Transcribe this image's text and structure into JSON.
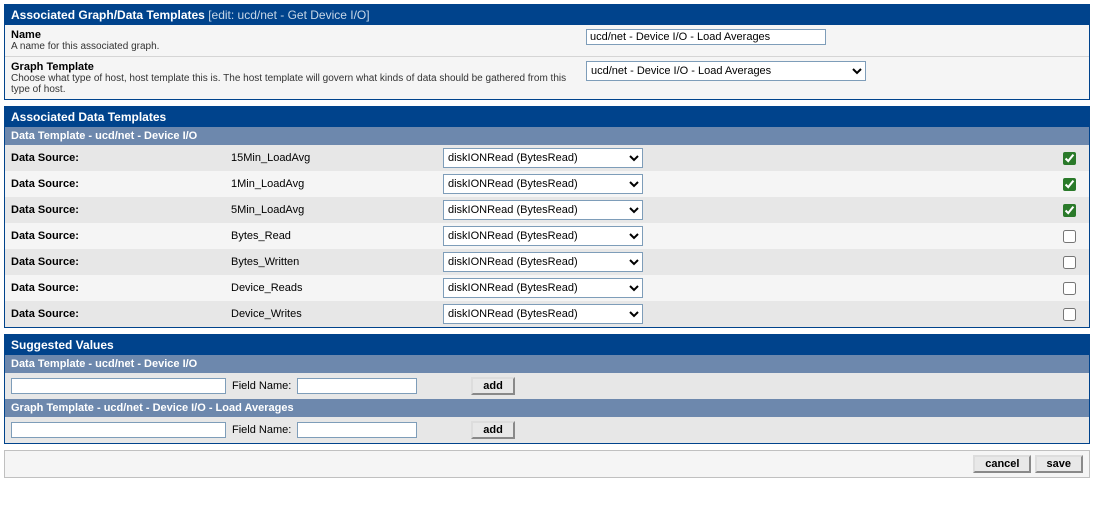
{
  "headers": {
    "main_title": "Associated Graph/Data Templates",
    "edit_info": "[edit: ucd/net - Get Device I/O]",
    "assoc_dt": "Associated Data Templates",
    "dt_sub": "Data Template - ucd/net - Device I/O",
    "suggested": "Suggested Values",
    "sv_dt": "Data Template - ucd/net - Device I/O",
    "sv_gt": "Graph Template - ucd/net - Device I/O - Load Averages"
  },
  "labels": {
    "name": "Name",
    "name_desc": "A name for this associated graph.",
    "gt": "Graph Template",
    "gt_desc": "Choose what type of host, host template this is. The host template will govern what kinds of data should be gathered from this type of host.",
    "data_source": "Data Source:",
    "field_name": "Field Name:",
    "add": "add",
    "cancel": "cancel",
    "save": "save"
  },
  "values": {
    "name_input": "ucd/net - Device I/O - Load Averages",
    "gt_select": "ucd/net - Device I/O - Load Averages",
    "ds_option": "diskIONRead (BytesRead)"
  },
  "data_sources": [
    {
      "name": "15Min_LoadAvg",
      "checked": true
    },
    {
      "name": "1Min_LoadAvg",
      "checked": true
    },
    {
      "name": "5Min_LoadAvg",
      "checked": true
    },
    {
      "name": "Bytes_Read",
      "checked": false
    },
    {
      "name": "Bytes_Written",
      "checked": false
    },
    {
      "name": "Device_Reads",
      "checked": false
    },
    {
      "name": "Device_Writes",
      "checked": false
    }
  ]
}
